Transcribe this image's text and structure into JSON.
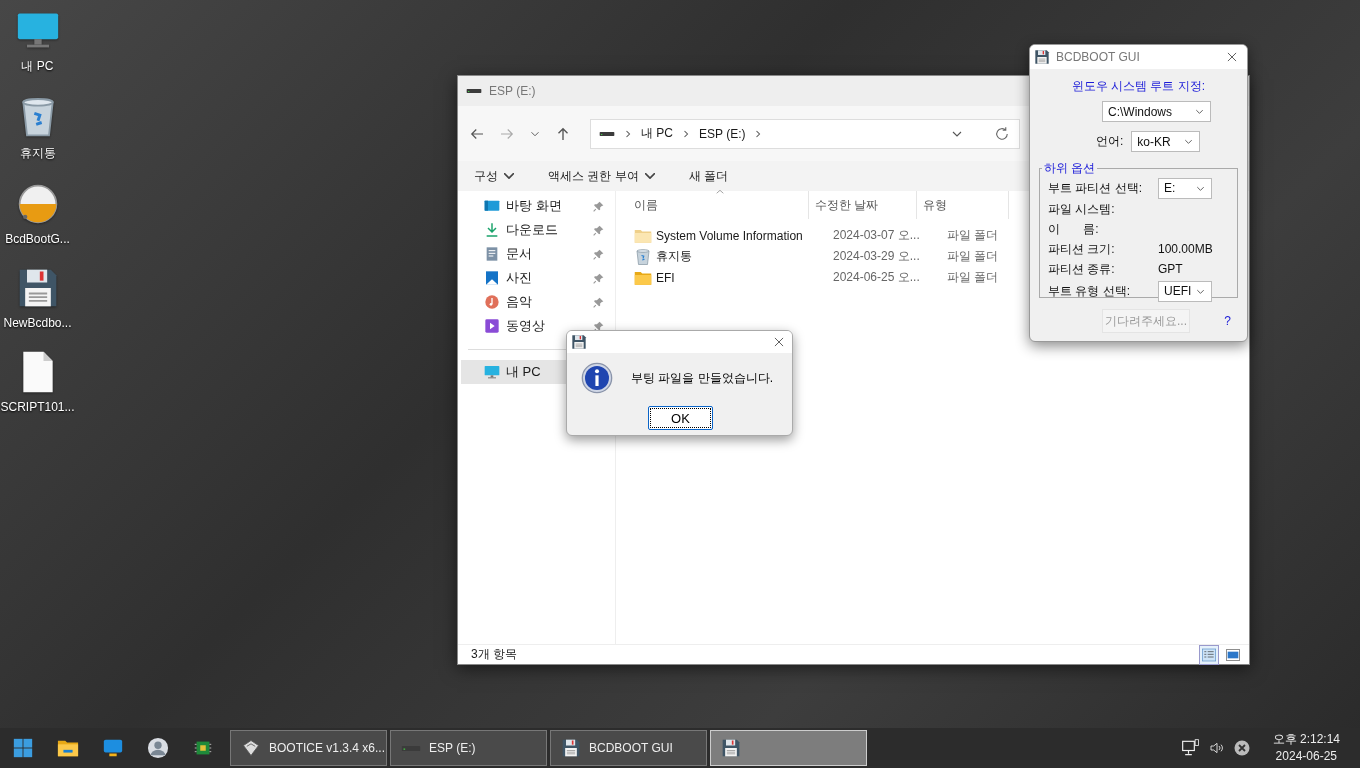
{
  "desktop_icons": [
    {
      "label": "내 PC",
      "kind": "pc"
    },
    {
      "label": "휴지통",
      "kind": "recycle"
    },
    {
      "label": "BcdBootG...",
      "kind": "sphere"
    },
    {
      "label": "NewBcdbo...",
      "kind": "floppy"
    },
    {
      "label": "SCRIPT101...",
      "kind": "file"
    }
  ],
  "explorer": {
    "title": "ESP (E:)",
    "breadcrumb": [
      "내 PC",
      "ESP (E:)"
    ],
    "toolbar": [
      {
        "label": "구성",
        "menu": true
      },
      {
        "label": "액세스 권한 부여",
        "menu": true
      },
      {
        "label": "새 폴더",
        "menu": false
      }
    ],
    "nav_items": [
      {
        "label": "바탕 화면",
        "kind": "desktop",
        "pinned": true,
        "selected": false
      },
      {
        "label": "다운로드",
        "kind": "download",
        "pinned": true,
        "selected": false
      },
      {
        "label": "문서",
        "kind": "document",
        "pinned": true,
        "selected": false
      },
      {
        "label": "사진",
        "kind": "photo",
        "pinned": true,
        "selected": false
      },
      {
        "label": "음악",
        "kind": "music",
        "pinned": true,
        "selected": false
      },
      {
        "label": "동영상",
        "kind": "video",
        "pinned": true,
        "selected": false
      },
      {
        "label": "내 PC",
        "kind": "pc",
        "selected": true
      }
    ],
    "columns": [
      "이름",
      "수정한 날짜",
      "유형"
    ],
    "rows": [
      {
        "name": "System Volume Information",
        "date": "2024-03-07 오...",
        "type": "파일 폴더",
        "kind": "folder-faded"
      },
      {
        "name": "휴지통",
        "date": "2024-03-29 오...",
        "type": "파일 폴더",
        "kind": "recycle"
      },
      {
        "name": "EFI",
        "date": "2024-06-25 오...",
        "type": "파일 폴더",
        "kind": "folder"
      }
    ],
    "status": "3개 항목",
    "views": [
      {
        "kind": "details",
        "selected": true
      },
      {
        "kind": "tiles",
        "selected": false
      }
    ]
  },
  "message_box": {
    "message": "부팅 파일을 만들었습니다.",
    "button": "OK"
  },
  "bcdboot": {
    "title": "BCDBOOT GUI",
    "root_label": "윈도우 시스템 루트 지정:",
    "root_value": "C:\\Windows",
    "language_label": "언어:",
    "language_value": "ko-KR",
    "group_title": "하위 옵션",
    "fields": [
      {
        "label": "부트 파티션 선택:",
        "kind": "select",
        "value": "E:"
      },
      {
        "label": "파일 시스템:",
        "kind": "text"
      },
      {
        "label": "이       름:",
        "kind": "text"
      },
      {
        "label": "파티션 크기:",
        "kind": "text",
        "value": "100.00MB"
      },
      {
        "label": "파티션 종류:",
        "kind": "text",
        "value": "GPT"
      },
      {
        "label": "부트 유형 선택:",
        "kind": "select",
        "value": "UEFI"
      }
    ],
    "button": {
      "label": "기다려주세요...",
      "disabled": true
    },
    "help": "?"
  },
  "taskbar": {
    "pinned": [
      {
        "kind": "windows"
      },
      {
        "kind": "folder"
      },
      {
        "kind": "monitor"
      },
      {
        "kind": "avatar"
      },
      {
        "kind": "chip"
      }
    ],
    "tasks": [
      {
        "label": "BOOTICE v1.3.4 x6...",
        "kind": "disks",
        "selected": false
      },
      {
        "label": "ESP (E:)",
        "kind": "drive",
        "selected": false
      },
      {
        "label": "BCDBOOT GUI",
        "kind": "floppy",
        "selected": false
      },
      {
        "kind": "floppy",
        "selected": true
      }
    ],
    "time": "오후 2:12:14",
    "date": "2024-06-25"
  }
}
